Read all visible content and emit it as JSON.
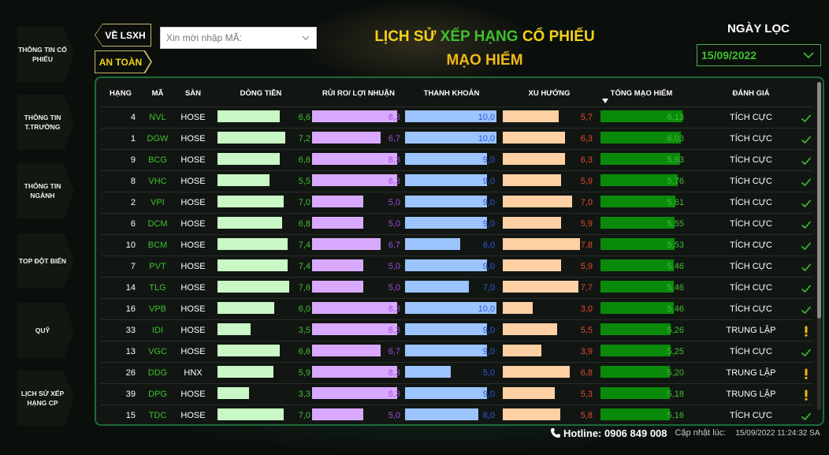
{
  "nav": {
    "items": [
      {
        "label": "THÔNG TIN CỔ PHIẾU"
      },
      {
        "label": "THÔNG TIN T.TRƯỜNG"
      },
      {
        "label": "THÔNG TIN NGÀNH"
      },
      {
        "label": "TOP ĐỘT BIẾN"
      },
      {
        "label": "QUỸ"
      },
      {
        "label": "LỊCH SỬ XẾP HẠNG CP"
      }
    ]
  },
  "toolbar": {
    "back_label": "VỀ LSXH",
    "safe_label": "AN TOÀN"
  },
  "search": {
    "placeholder": "Xin mời nhập MÃ:"
  },
  "header": {
    "title_part1": "LỊCH SỬ ",
    "title_part2": "XẾP HẠNG",
    "title_part3": " CỔ PHIẾU",
    "subtitle": "MẠO HIỂM"
  },
  "date_filter": {
    "label": "NGÀY LỌC",
    "value": "15/09/2022"
  },
  "table": {
    "headers": {
      "rank": "HẠNG",
      "code": "MÃ",
      "exchange": "SÀN",
      "cashflow": "DÒNG TIỀN",
      "risk": "RỦI RO/ LỢI NHUẬN",
      "liquidity": "THANH KHOẢN",
      "trend": "XU HƯỚNG",
      "total": "TỔNG MẠO HIỂM",
      "rating": "ĐÁNH GIÁ"
    },
    "rows": [
      {
        "rank": "4",
        "code": "NVL",
        "exchange": "HOSE",
        "cashflow": "6,6",
        "risk": "8,3",
        "liquidity": "10,0",
        "trend": "5,7",
        "total": "6,13",
        "rating": "TÍCH CỰC",
        "status": "check"
      },
      {
        "rank": "1",
        "code": "DGW",
        "exchange": "HOSE",
        "cashflow": "7,2",
        "risk": "6,7",
        "liquidity": "10,0",
        "trend": "6,3",
        "total": "6,03",
        "rating": "TÍCH CỰC",
        "status": "check"
      },
      {
        "rank": "9",
        "code": "BCG",
        "exchange": "HOSE",
        "cashflow": "6,6",
        "risk": "8,3",
        "liquidity": "9,0",
        "trend": "6,3",
        "total": "5,93",
        "rating": "TÍCH CỰC",
        "status": "check"
      },
      {
        "rank": "8",
        "code": "VHC",
        "exchange": "HOSE",
        "cashflow": "5,5",
        "risk": "8,3",
        "liquidity": "9,0",
        "trend": "5,9",
        "total": "5,76",
        "rating": "TÍCH CỰC",
        "status": "check"
      },
      {
        "rank": "2",
        "code": "VPI",
        "exchange": "HOSE",
        "cashflow": "7,0",
        "risk": "5,0",
        "liquidity": "9,0",
        "trend": "7,0",
        "total": "5,61",
        "rating": "TÍCH CỰC",
        "status": "check"
      },
      {
        "rank": "6",
        "code": "DCM",
        "exchange": "HOSE",
        "cashflow": "6,8",
        "risk": "5,0",
        "liquidity": "9,0",
        "trend": "5,9",
        "total": "5,55",
        "rating": "TÍCH CỰC",
        "status": "check"
      },
      {
        "rank": "10",
        "code": "BCM",
        "exchange": "HOSE",
        "cashflow": "7,4",
        "risk": "6,7",
        "liquidity": "6,0",
        "trend": "7,8",
        "total": "5,53",
        "rating": "TÍCH CỰC",
        "status": "check"
      },
      {
        "rank": "7",
        "code": "PVT",
        "exchange": "HOSE",
        "cashflow": "7,4",
        "risk": "5,0",
        "liquidity": "9,0",
        "trend": "5,9",
        "total": "5,46",
        "rating": "TÍCH CỰC",
        "status": "check"
      },
      {
        "rank": "14",
        "code": "TLG",
        "exchange": "HOSE",
        "cashflow": "7,6",
        "risk": "5,0",
        "liquidity": "7,0",
        "trend": "7,7",
        "total": "5,46",
        "rating": "TÍCH CỰC",
        "status": "check"
      },
      {
        "rank": "16",
        "code": "VPB",
        "exchange": "HOSE",
        "cashflow": "6,0",
        "risk": "8,3",
        "liquidity": "10,0",
        "trend": "3,0",
        "total": "5,46",
        "rating": "TÍCH CỰC",
        "status": "check"
      },
      {
        "rank": "33",
        "code": "IDI",
        "exchange": "HOSE",
        "cashflow": "3,5",
        "risk": "8,3",
        "liquidity": "9,0",
        "trend": "5,5",
        "total": "5,26",
        "rating": "TRUNG LẬP",
        "status": "warn"
      },
      {
        "rank": "13",
        "code": "VGC",
        "exchange": "HOSE",
        "cashflow": "6,6",
        "risk": "6,7",
        "liquidity": "9,0",
        "trend": "3,9",
        "total": "5,25",
        "rating": "TÍCH CỰC",
        "status": "check"
      },
      {
        "rank": "26",
        "code": "DDG",
        "exchange": "HNX",
        "cashflow": "5,9",
        "risk": "8,3",
        "liquidity": "5,0",
        "trend": "6,8",
        "total": "5,20",
        "rating": "TRUNG LẬP",
        "status": "warn"
      },
      {
        "rank": "39",
        "code": "DPG",
        "exchange": "HOSE",
        "cashflow": "3,3",
        "risk": "8,3",
        "liquidity": "9,0",
        "trend": "5,3",
        "total": "5,18",
        "rating": "TRUNG LẬP",
        "status": "warn"
      },
      {
        "rank": "15",
        "code": "TDC",
        "exchange": "HOSE",
        "cashflow": "7,0",
        "risk": "5,0",
        "liquidity": "8,0",
        "trend": "5,8",
        "total": "5,16",
        "rating": "TÍCH CỰC",
        "status": "check"
      }
    ]
  },
  "footer": {
    "hotline": "Hotline: 0906 849 008",
    "updated_label": "Cập nhật lúc:",
    "updated_value": "15/09/2022 11:24:32 SA"
  },
  "colors": {
    "cashflow": "#c9f7c5",
    "risk": "#d9a9ff",
    "liquidity": "#9cc4ff",
    "trend": "#ffd0a3",
    "total": "#0a8a0a",
    "code": "#3fbf2f",
    "risk_text": "#a44bd8",
    "liquidity_text": "#2d5ad8",
    "trend_text": "#e24a2c",
    "check": "#3fbf2f",
    "warn": "#f0b51b"
  }
}
